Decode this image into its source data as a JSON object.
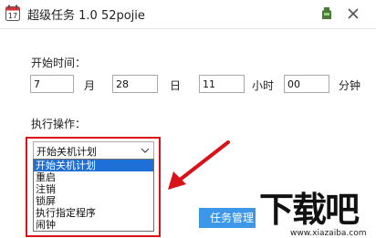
{
  "window": {
    "title": "超级任务 1.0 52pojie",
    "icons": [
      "calendar-icon",
      "skin-icon",
      "close-icon"
    ]
  },
  "start_time": {
    "label": "开始时间：",
    "month_value": "7",
    "month_unit": "月",
    "day_value": "28",
    "day_unit": "日",
    "hour_value": "11",
    "hour_unit": "小时",
    "minute_value": "00",
    "minute_unit": "分钟"
  },
  "action": {
    "label": "执行操作：",
    "selected": "开始关机计划",
    "options": [
      "开始关机计划",
      "重启",
      "注销",
      "锁屏",
      "执行指定程序",
      "闹钟"
    ]
  },
  "buttons": {
    "task_manage": "任务管理"
  },
  "watermark": {
    "brand": "下载吧",
    "url": "www.xiazaiba.com"
  },
  "colors": {
    "highlight_box": "#d9121a",
    "selected_option": "#1e6fd6",
    "button_blue": "#3c97e8"
  }
}
